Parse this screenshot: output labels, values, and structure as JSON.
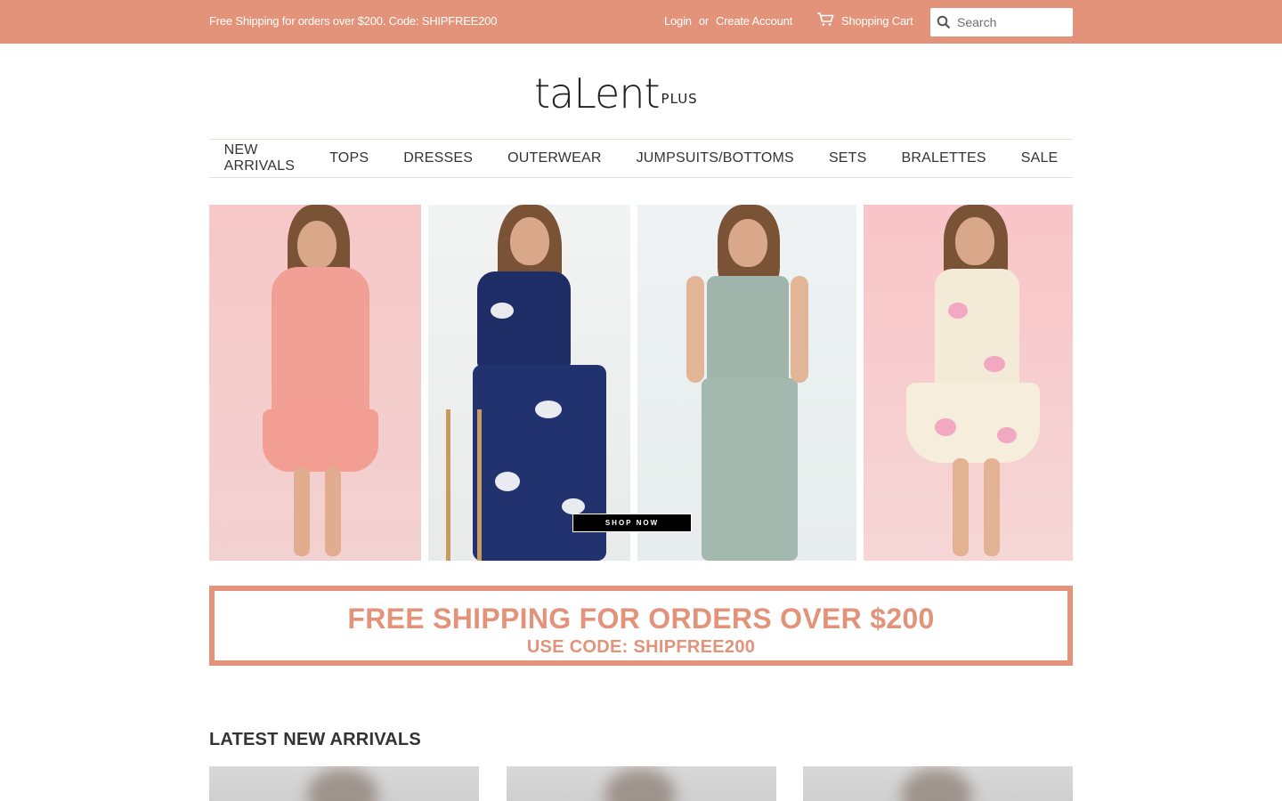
{
  "topbar": {
    "promo": "Free Shipping for orders over $200. Code: SHIPFREE200",
    "login": "Login",
    "or": "or",
    "create_account": "Create Account",
    "cart": "Shopping Cart",
    "search_placeholder": "Search",
    "bg_color": "#e2937a"
  },
  "logo": {
    "main": "taLent",
    "sub": "PLUS"
  },
  "nav": {
    "items": [
      "NEW ARRIVALS",
      "TOPS",
      "DRESSES",
      "OUTERWEAR",
      "JUMPSUITS/BOTTOMS",
      "SETS",
      "BRALETTES",
      "SALE"
    ]
  },
  "hero": {
    "cta": "SHOP NOW"
  },
  "banner": {
    "line1": "FREE SHIPPING FOR ORDERS OVER $200",
    "line2": "USE CODE: SHIPFREE200",
    "color": "#e2937a"
  },
  "section": {
    "title": "LATEST NEW ARRIVALS"
  }
}
